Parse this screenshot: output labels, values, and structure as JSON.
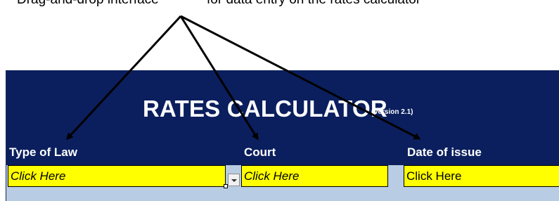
{
  "caption": {
    "left_text": "Drag-and-drop interface",
    "right_text": "for data entry on the rates calculator"
  },
  "header": {
    "title": "RATES CALCULATOR",
    "version": "(Version 2.1)"
  },
  "fields": {
    "type_of_law": {
      "label": "Type of Law",
      "value": "Click Here"
    },
    "court": {
      "label": "Court",
      "value": "Click Here"
    },
    "date_of_issue": {
      "label": "Date of issue",
      "value": "Click Here"
    }
  },
  "colors": {
    "header_band": "#0b1f5e",
    "field_fill": "#ffff00",
    "sheet_background": "#b8cce4",
    "arrow": "#000000"
  },
  "icons": {
    "dropdown": "chevron-down-icon",
    "arrow": "arrow-icon"
  }
}
